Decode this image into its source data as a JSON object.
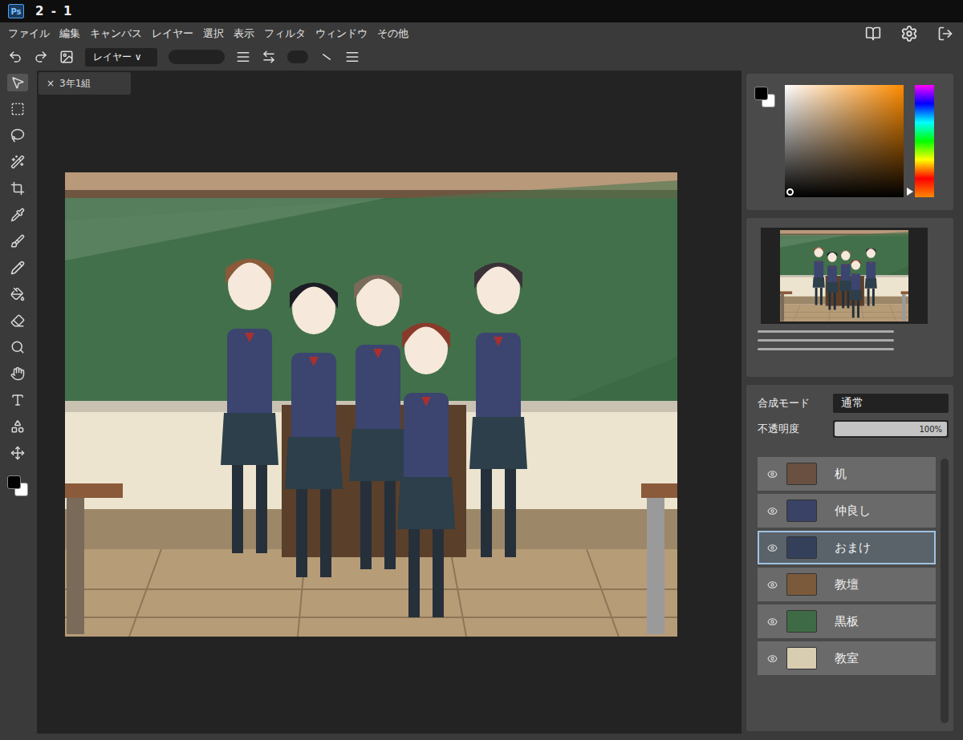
{
  "window": {
    "logo": "Ps",
    "title": "2 - 1"
  },
  "menu": [
    "ファイル",
    "編集",
    "キャンバス",
    "レイヤー",
    "選択",
    "表示",
    "フィルタ",
    "ウィンドウ",
    "その他"
  ],
  "toolbar": {
    "layer_select": "レイヤー ∨"
  },
  "document_tab": {
    "close": "×",
    "title": "3年1組"
  },
  "layers_panel": {
    "blend_mode_label": "合成モード",
    "blend_mode": "通常",
    "opacity_label": "不透明度",
    "opacity": "100%",
    "opacity_level": 1
  },
  "layers": [
    {
      "name": "机",
      "visible": true,
      "selected": false,
      "color": "#6a5040"
    },
    {
      "name": "仲良し",
      "visible": true,
      "selected": false,
      "color": "#3a4266"
    },
    {
      "name": "おまけ",
      "visible": true,
      "selected": true,
      "color": "#34405a"
    },
    {
      "name": "教壇",
      "visible": true,
      "selected": false,
      "color": "#7a5a3a"
    },
    {
      "name": "黒板",
      "visible": true,
      "selected": false,
      "color": "#3e6b45"
    },
    {
      "name": "教室",
      "visible": true,
      "selected": false,
      "color": "#d8cdb0"
    }
  ]
}
